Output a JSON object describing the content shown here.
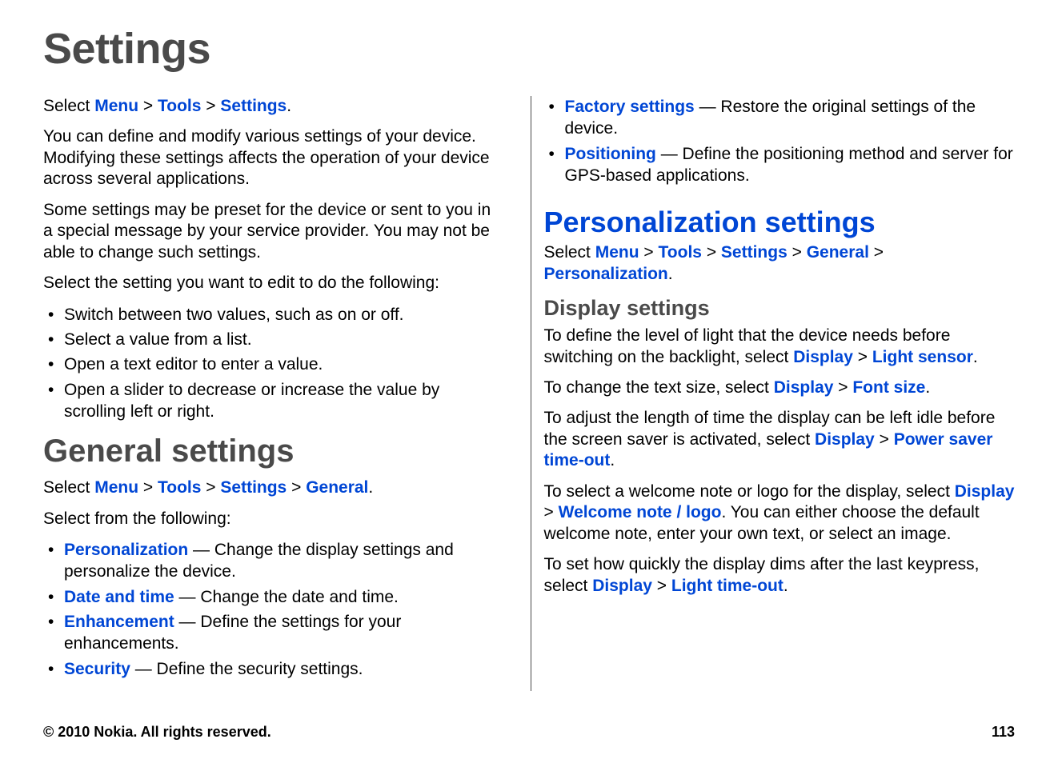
{
  "page_title": "Settings",
  "footer": {
    "copyright": "© 2010 Nokia. All rights reserved.",
    "page_number": "113"
  },
  "left": {
    "intro_select_prefix": "Select ",
    "intro_path": [
      "Menu",
      "Tools",
      "Settings"
    ],
    "intro_end": ".",
    "p1": "You can define and modify various settings of your device. Modifying these settings affects the operation of your device across several applications.",
    "p2": "Some settings may be preset for the device or sent to you in a special message by your service provider. You may not be able to change such settings.",
    "p3": "Select the setting you want to edit to do the following:",
    "actions": [
      "Switch between two values, such as on or off.",
      "Select a value from a list.",
      "Open a text editor to enter a value.",
      "Open a slider to decrease or increase the value by scrolling left or right."
    ],
    "general_heading": "General settings",
    "general_select_prefix": "Select ",
    "general_path": [
      "Menu",
      "Tools",
      "Settings",
      "General"
    ],
    "general_end": ".",
    "general_sub": "Select from the following:",
    "general_items": [
      {
        "label": "Personalization",
        "desc": " — Change the display settings and personalize the device."
      },
      {
        "label": "Date and time",
        "desc": " — Change the date and time."
      },
      {
        "label": "Enhancement",
        "desc": " — Define the settings for your enhancements."
      },
      {
        "label": "Security",
        "desc": " — Define the security settings."
      }
    ]
  },
  "right": {
    "top_items": [
      {
        "label": "Factory settings",
        "desc": " — Restore the original settings of the device."
      },
      {
        "label": "Positioning",
        "desc": " — Define the positioning method and server for GPS-based applications."
      }
    ],
    "pers_heading": "Personalization settings",
    "pers_select_prefix": "Select ",
    "pers_path": [
      "Menu",
      "Tools",
      "Settings",
      "General",
      "Personalization"
    ],
    "pers_end": ".",
    "display_heading": "Display settings",
    "d1_pre": "To define the level of light that the device needs before switching on the backlight, select ",
    "d1_path": [
      "Display",
      "Light sensor"
    ],
    "d2_pre": "To change the text size, select ",
    "d2_path": [
      "Display",
      "Font size"
    ],
    "d3_pre": "To adjust the length of time the display can be left idle before the screen saver is activated, select ",
    "d3_path": [
      "Display",
      "Power saver time-out"
    ],
    "d4_pre": "To select a welcome note or logo for the display, select ",
    "d4_path": [
      "Display",
      "Welcome note / logo"
    ],
    "d4_post": ". You can either choose the default welcome note, enter your own text, or select an image.",
    "d5_pre": "To set how quickly the display dims after the last keypress, select ",
    "d5_path": [
      "Display",
      "Light time-out"
    ]
  }
}
